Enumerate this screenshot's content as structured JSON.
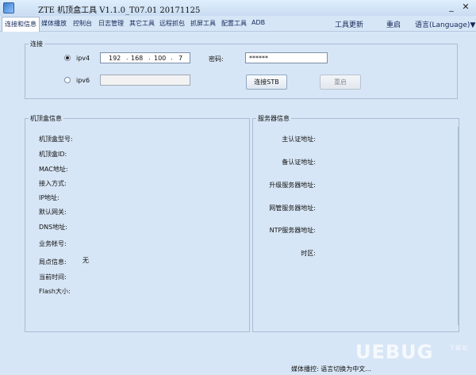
{
  "window": {
    "title": "ZTE  机顶盒工具  V1.1.0_T07.01  20171125",
    "minimize": "_",
    "close": "✕"
  },
  "menu": {
    "tabs": [
      "连接和信息",
      "媒体播放",
      "控制台",
      "日志管理",
      "其它工具",
      "远程抓包",
      "抓屏工具",
      "配置工具",
      "ADB"
    ],
    "update": "工具更新",
    "restart": "重启",
    "language": "语言(Language)▼"
  },
  "connect": {
    "title": "连接",
    "ipv4_label": "ipv4",
    "ipv6_label": "ipv6",
    "ip": [
      "192",
      "168",
      "100",
      "7"
    ],
    "password_label": "密码:",
    "password_value": "******",
    "connect_button": "连接STB",
    "restart_button": "重启"
  },
  "stb_info": {
    "title": "机顶盒信息",
    "rows": [
      {
        "label": "机顶盒型号:",
        "value": ""
      },
      {
        "label": "机顶盒ID:",
        "value": ""
      },
      {
        "label": "MAC地址:",
        "value": ""
      },
      {
        "label": "接入方式:",
        "value": ""
      },
      {
        "label": "IP地址:",
        "value": ""
      },
      {
        "label": "默认网关:",
        "value": ""
      },
      {
        "label": "DNS地址:",
        "value": ""
      },
      {
        "label": "业务帐号:",
        "value": ""
      },
      {
        "label": "局点信息:",
        "value": "无"
      },
      {
        "label": "当前时间:",
        "value": ""
      },
      {
        "label": "Flash大小:",
        "value": ""
      }
    ]
  },
  "server_info": {
    "title": "服务器信息",
    "rows": [
      {
        "label": "主认证地址:"
      },
      {
        "label": "备认证地址:"
      },
      {
        "label": "升级服务器地址:"
      },
      {
        "label": "网管服务器地址:"
      },
      {
        "label": "NTP服务器地址:"
      },
      {
        "label": "时区:"
      }
    ]
  },
  "status": {
    "text": "媒体播控: 语言切换为中文..."
  },
  "watermark": {
    "text": "UEBUG",
    "small": "下载站"
  }
}
